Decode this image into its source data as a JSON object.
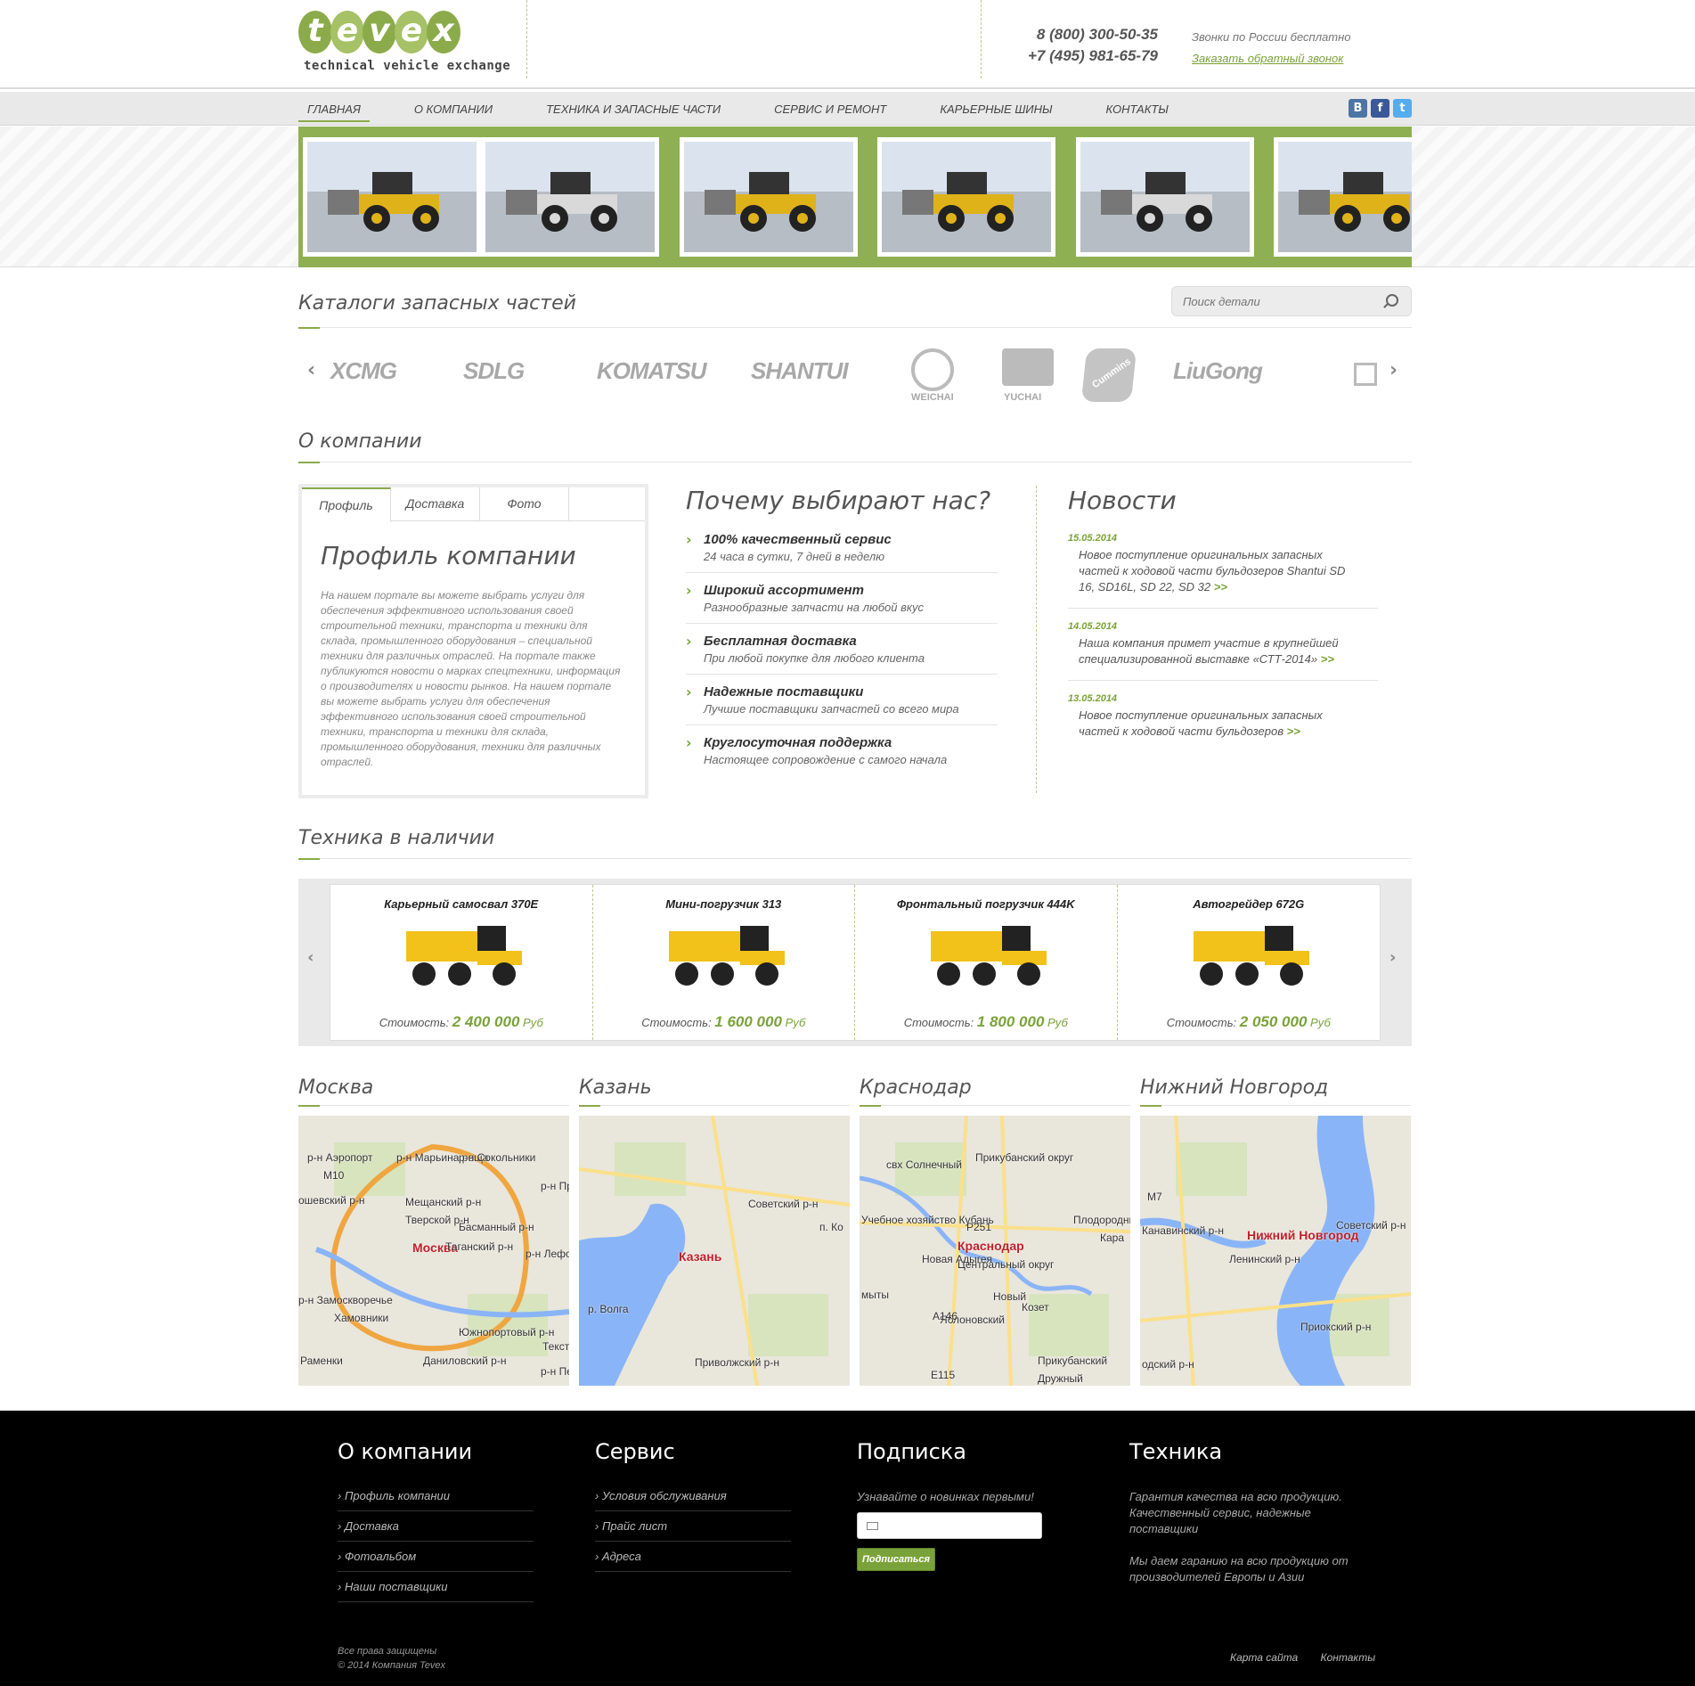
{
  "brand": {
    "logo_letters": [
      "t",
      "e",
      "v",
      "e",
      "x"
    ],
    "tagline": "technical vehicle exchange",
    "accent": "#8bab4a"
  },
  "header": {
    "phone1": "8 (800) 300-50-35",
    "phone2": "+7 (495) 981-65-79",
    "free_calls": "Звонки по России бесплатно",
    "callback_link": "Заказать обратный звонок"
  },
  "nav": {
    "items": [
      "Главная",
      "О компании",
      "Техника и запасные части",
      "Сервис и ремонт",
      "Карьерные шины",
      "Контакты"
    ],
    "active": "Главная",
    "socials": [
      {
        "icon": "vk-icon",
        "glyph": "В",
        "color": "#4c75a3"
      },
      {
        "icon": "facebook-icon",
        "glyph": "f",
        "color": "#3b5998"
      },
      {
        "icon": "twitter-icon",
        "glyph": "t",
        "color": "#55acee"
      }
    ]
  },
  "catalogs": {
    "title": "Каталоги запасных частей",
    "search_placeholder": "Поиск детали",
    "brands": [
      "XCMG",
      "SDLG",
      "KOMATSU",
      "SHANTUI",
      "WEICHAI",
      "YUCHAI",
      "Cummins",
      "LiuGong"
    ],
    "prev": "‹",
    "next": "›"
  },
  "about": {
    "title": "О компании",
    "tabs": [
      "Профиль",
      "Доставка",
      "Фото"
    ],
    "active_tab": "Профиль",
    "profile_title": "Профиль компании",
    "profile_text": "На нашем портале вы можете выбрать услуги для обеспечения эффективного использования своей строительной техники, транспорта и техники для склада, промышленного оборудования – специальной техники для различных отраслей. На портале также публикуются новости о марках спецтехники, информация о производителях и новости рынков. На нашем портале вы можете выбрать услуги для обеспечения эффективного использования своей строительной техники, транспорта и техники для склада, промышленного оборудования, техники для различных отраслей."
  },
  "why": {
    "title": "Почему выбирают нас?",
    "items": [
      {
        "head": "100% качественный сервис",
        "sub": "24 часа в сутки, 7 дней в неделю"
      },
      {
        "head": "Широкий ассортимент",
        "sub": "Разнообразные запчасти на любой вкус"
      },
      {
        "head": "Бесплатная доставка",
        "sub": "При любой покупке для любого клиента"
      },
      {
        "head": "Надежные поставщики",
        "sub": "Лучшие поставщики запчастей со всего мира"
      },
      {
        "head": "Круглосуточная поддержка",
        "sub": "Настоящее сопровождение с самого начала"
      }
    ]
  },
  "news": {
    "title": "Новости",
    "more": ">>",
    "items": [
      {
        "date": "15.05.2014",
        "text": "Новое поступление оригинальных запасных частей к ходовой части бульдозеров Shantui SD 16, SD16L, SD 22, SD 32"
      },
      {
        "date": "14.05.2014",
        "text": "Наша компания примет участие в крупнейшей специализированной выставке «СТТ-2014»"
      },
      {
        "date": "13.05.2014",
        "text": "Новое поступление оригинальных запасных частей к ходовой части бульдозеров"
      }
    ]
  },
  "stock": {
    "title": "Техника в наличии",
    "price_label": "Стоимость:",
    "currency": "Руб",
    "items": [
      {
        "name": "Карьерный самосвал 370E",
        "price": "2 400 000"
      },
      {
        "name": "Мини-погрузчик 313",
        "price": "1 600 000"
      },
      {
        "name": "Фронтальный погрузчик 444K",
        "price": "1 800 000"
      },
      {
        "name": "Автогрейдер 672G",
        "price": "2 050 000"
      }
    ]
  },
  "maps": [
    {
      "city": "Москва",
      "labels": [
        "Москва",
        "Мещанский р-н",
        "Тверской р-н",
        "Басманный р-н",
        "Таганский р-н",
        "р-н Замоскворечье",
        "Хамовники",
        "Южнопортовый р-н",
        "Даниловский р-н",
        "р-н Марьина роща",
        "р-н Сокольники",
        "р-н Аэропорт",
        "р-н Лефор",
        "р-н Прес",
        "ошевский р-н",
        "Раменки",
        "Текст",
        "р-н Печа",
        "M10"
      ]
    },
    {
      "city": "Казань",
      "labels": [
        "Казань",
        "Советский р-н",
        "Приволжский р-н",
        "р. Волга",
        "п. Ко"
      ]
    },
    {
      "city": "Краснодар",
      "labels": [
        "Краснодар",
        "Прикубанский округ",
        "Центральный округ",
        "Новая Адыгея",
        "Яблоновский",
        "Новый",
        "Козет",
        "свх Солнечный",
        "Учебное хозяйство Кубань",
        "Плодородный",
        "Дружный",
        "Прикубанский",
        "Кара",
        "мыты",
        "P251",
        "E115",
        "A146"
      ]
    },
    {
      "city": "Нижний Новгород",
      "labels": [
        "Нижний Новгород",
        "Канавинский р-н",
        "Ленинский р-н",
        "Советский р-н",
        "Приокский р-н",
        "одский р-н",
        "M7"
      ]
    }
  ],
  "footer": {
    "col1": {
      "title": "О компании",
      "links": [
        "Профиль компании",
        "Доставка",
        "Фотоальбом",
        "Наши поставщики"
      ]
    },
    "col2": {
      "title": "Сервис",
      "links": [
        "Условия обслуживания",
        "Прайс лист",
        "Адреса"
      ]
    },
    "col3": {
      "title": "Подписка",
      "hint": "Узнавайте о новинках первыми!",
      "button": "Подписаться"
    },
    "col4": {
      "title": "Техника",
      "text1": "Гарантия качества на всю продукцию. Качественный сервис, надежные поставщики",
      "text2": "Мы даем гаранию на всю продукцию от производителей Европы и Азии"
    },
    "copyright1": "Все права защищены",
    "copyright2": "© 2014 Компания Tevex",
    "bottom_links": [
      "Карта сайта",
      "Контакты"
    ]
  }
}
